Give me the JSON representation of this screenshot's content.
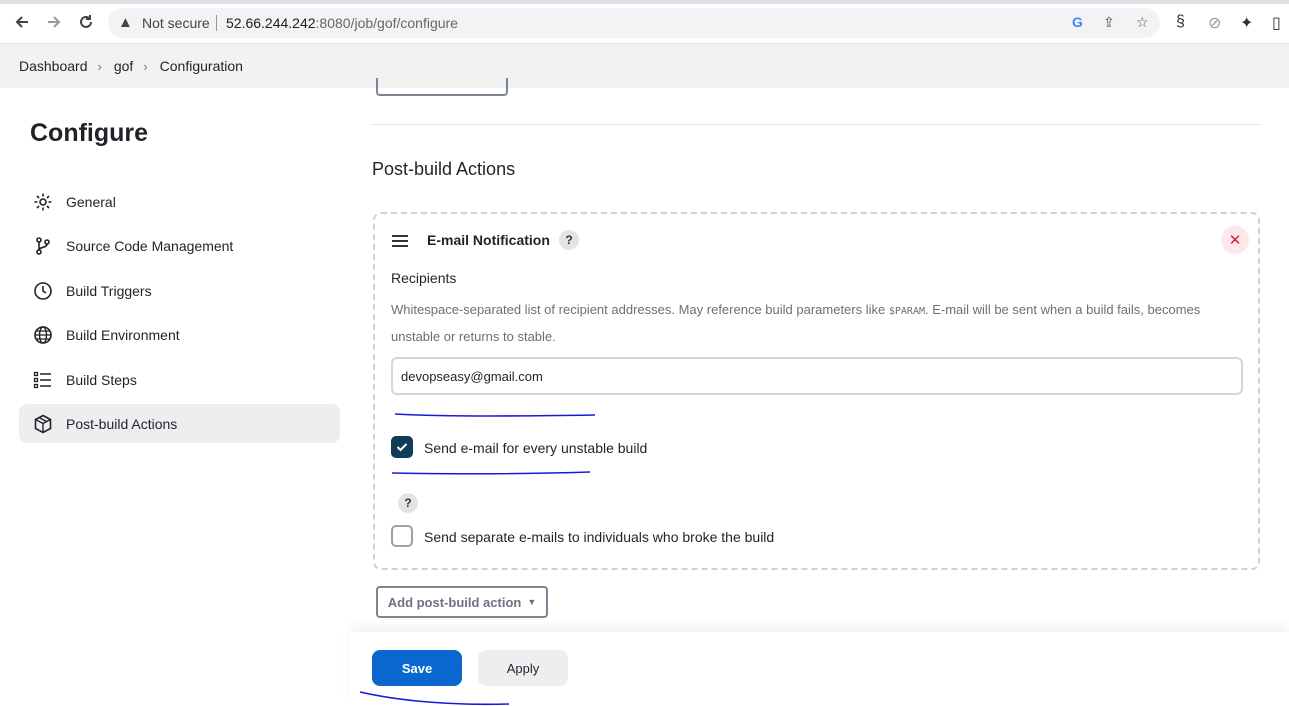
{
  "browser": {
    "back_icon": "arrow-left-icon",
    "forward_icon": "arrow-right-icon",
    "reload_icon": "reload-icon",
    "security_label": "Not secure",
    "url_host": "52.66.244.242",
    "url_rest": ":8080/job/gof/configure"
  },
  "breadcrumb": {
    "items": [
      "Dashboard",
      "gof",
      "Configuration"
    ]
  },
  "sidebar": {
    "title": "Configure",
    "items": [
      {
        "label": "General",
        "icon": "gear-icon"
      },
      {
        "label": "Source Code Management",
        "icon": "branch-icon"
      },
      {
        "label": "Build Triggers",
        "icon": "clock-icon"
      },
      {
        "label": "Build Environment",
        "icon": "globe-icon"
      },
      {
        "label": "Build Steps",
        "icon": "list-icon"
      },
      {
        "label": "Post-build Actions",
        "icon": "package-icon"
      }
    ]
  },
  "main": {
    "section_title": "Post-build Actions",
    "email_panel": {
      "title": "E-mail Notification",
      "help": "?",
      "recipients_label": "Recipients",
      "desc_before": "Whitespace-separated list of recipient addresses. May reference build parameters like ",
      "desc_code": "$PARAM",
      "desc_after": ". E-mail will be sent when a build fails, becomes unstable or returns to stable.",
      "recipients_value": "devopseasy@gmail.com",
      "unstable_checked": true,
      "unstable_label": "Send e-mail for every unstable build",
      "separate_checked": false,
      "separate_label": "Send separate e-mails to individuals who broke the build"
    },
    "add_action_label": "Add post-build action"
  },
  "footer": {
    "save_label": "Save",
    "apply_label": "Apply"
  },
  "colors": {
    "primary": "#0b67d0",
    "checkbox": "#0f3d57",
    "annotation": "#1a1ad6",
    "danger": "#d0223b"
  }
}
